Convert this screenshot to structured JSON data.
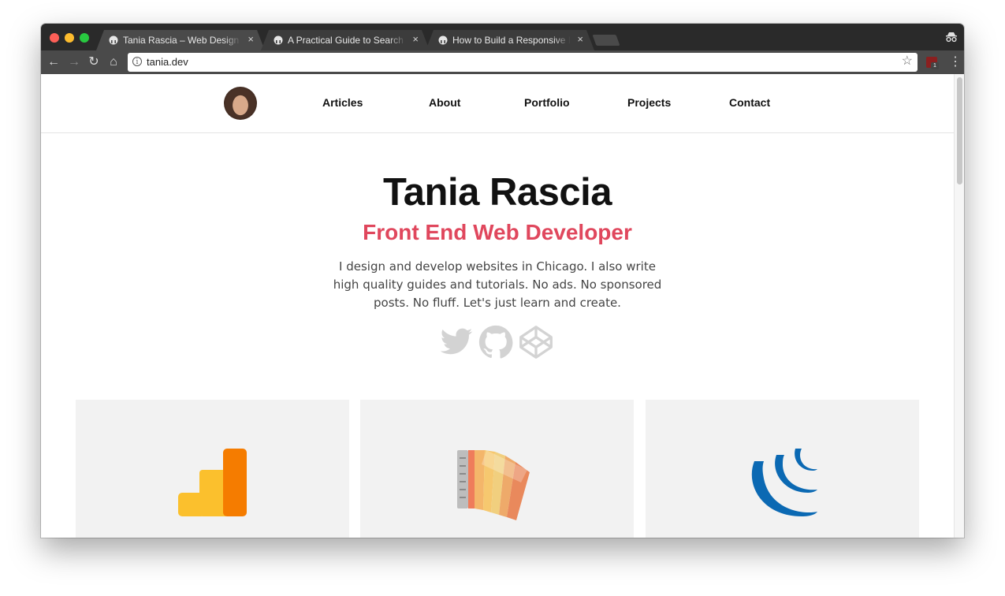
{
  "browser": {
    "tabs": [
      {
        "title": "Tania Rascia – Web Design and Development"
      },
      {
        "title": "A Practical Guide to Search Engine Optimization"
      },
      {
        "title": "How to Build a Responsive Image Gallery"
      }
    ],
    "close_glyph": "×",
    "address": "tania.dev",
    "info_glyph": "i",
    "star_glyph": "☆",
    "extension_badge": "1",
    "back_glyph": "←",
    "forward_glyph": "→",
    "reload_glyph": "↻",
    "home_glyph": "⌂",
    "menu_glyph": "⋮"
  },
  "nav": {
    "links": [
      {
        "label": "Articles"
      },
      {
        "label": "About"
      },
      {
        "label": "Portfolio"
      },
      {
        "label": "Projects"
      },
      {
        "label": "Contact"
      }
    ]
  },
  "hero": {
    "title": "Tania Rascia",
    "subtitle": "Front End Web Developer",
    "description": "I design and develop websites in Chicago. I also write high quality guides and tutorials. No ads. No sponsored posts. No fluff. Let's just learn and create."
  },
  "social_icons": [
    "twitter-icon",
    "github-icon",
    "codepen-icon"
  ],
  "cards": [
    {
      "icon": "google-analytics-icon"
    },
    {
      "icon": "color-palette-icon"
    },
    {
      "icon": "jquery-icon"
    }
  ],
  "colors": {
    "accent": "#e0475d",
    "social_icon": "#d3d3d3",
    "card_bg": "#f2f2f2",
    "chrome_dark": "#2a2a2a"
  }
}
